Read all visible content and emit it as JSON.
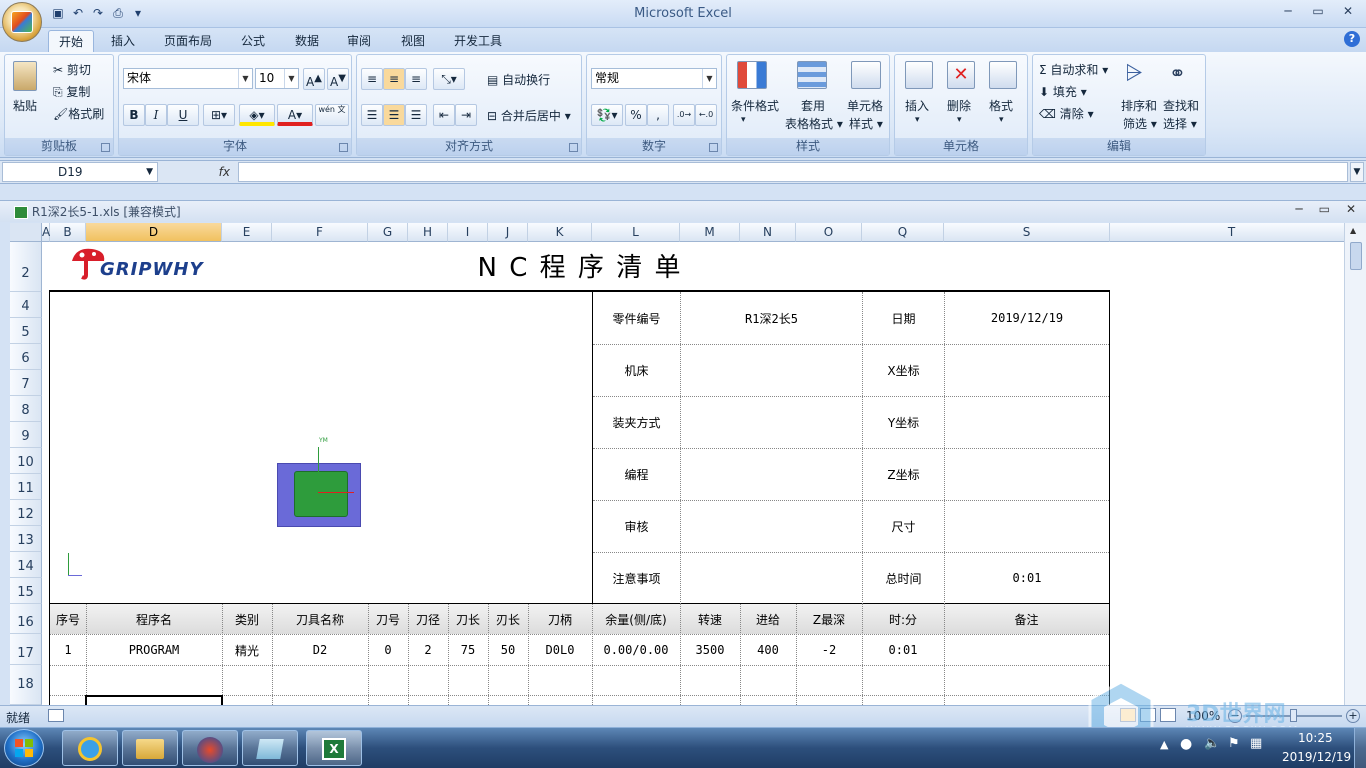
{
  "window": {
    "title": "Microsoft Excel"
  },
  "quick_access": {
    "customize": "▾"
  },
  "tabs": [
    {
      "label": "开始",
      "active": true
    },
    {
      "label": "插入"
    },
    {
      "label": "页面布局"
    },
    {
      "label": "公式"
    },
    {
      "label": "数据"
    },
    {
      "label": "审阅"
    },
    {
      "label": "视图"
    },
    {
      "label": "开发工具"
    }
  ],
  "ribbon": {
    "clipboard": {
      "label": "剪贴板",
      "paste": "粘贴",
      "cut": "剪切",
      "copy": "复制",
      "format_painter": "格式刷"
    },
    "font": {
      "label": "字体",
      "name": "宋体",
      "size": "10",
      "bold": "B",
      "italic": "I",
      "underline": "U",
      "phonetic": "wén 文"
    },
    "alignment": {
      "label": "对齐方式",
      "wrap": "自动换行",
      "merge": "合并后居中"
    },
    "number": {
      "label": "数字",
      "format": "常规",
      "percent": "%",
      "comma": ","
    },
    "styles": {
      "label": "样式",
      "conditional": "条件格式",
      "table_format_1": "套用",
      "table_format_2": "表格格式",
      "cell_styles_1": "单元格",
      "cell_styles_2": "样式"
    },
    "cells": {
      "label": "单元格",
      "insert": "插入",
      "delete": "删除",
      "format": "格式"
    },
    "editing": {
      "label": "编辑",
      "autosum": "自动求和",
      "fill": "填充",
      "clear": "清除",
      "sort_1": "排序和",
      "sort_2": "筛选",
      "find_1": "查找和",
      "find_2": "选择"
    }
  },
  "formula_bar": {
    "name_box": "D19",
    "fx": "fx",
    "value": ""
  },
  "workbook": {
    "title": "R1深2长5-1.xls  [兼容模式]"
  },
  "columns": [
    "A",
    "B",
    "D",
    "E",
    "F",
    "G",
    "H",
    "I",
    "J",
    "K",
    "L",
    "M",
    "N",
    "O",
    "Q",
    "S",
    "T"
  ],
  "rows": [
    "2",
    "4",
    "5",
    "6",
    "7",
    "8",
    "9",
    "10",
    "11",
    "12",
    "13",
    "14",
    "15",
    "16",
    "17",
    "18"
  ],
  "sheet": {
    "logo": "GRIPWHY",
    "title": "N C 程 序 清 单",
    "info": [
      {
        "l1": "零件编号",
        "v1": "R1深2长5",
        "l2": "日期",
        "v2": "2019/12/19"
      },
      {
        "l1": "机床",
        "v1": "",
        "l2": "X坐标",
        "v2": ""
      },
      {
        "l1": "装夹方式",
        "v1": "",
        "l2": "Y坐标",
        "v2": ""
      },
      {
        "l1": "编程",
        "v1": "",
        "l2": "Z坐标",
        "v2": ""
      },
      {
        "l1": "审核",
        "v1": "",
        "l2": "尺寸",
        "v2": ""
      },
      {
        "l1": "注意事项",
        "v1": "",
        "l2": "总时间",
        "v2": "0:01"
      }
    ],
    "headers": [
      "序号",
      "程序名",
      "类别",
      "刀具名称",
      "刀号",
      "刀径",
      "刀长",
      "刃长",
      "刀柄",
      "余量(侧/底)",
      "转速",
      "进给",
      "Z最深",
      "时:分",
      "备注"
    ],
    "rows": [
      [
        "1",
        "PROGRAM",
        "精光",
        "D2",
        "0",
        "2",
        "75",
        "50",
        "D0L0",
        "0.00/0.00",
        "3500",
        "400",
        "-2",
        "0:01",
        ""
      ]
    ],
    "axis_label": "YM"
  },
  "status": {
    "ready": "就绪",
    "zoom": "100%"
  },
  "watermark": {
    "text": "3D世界网",
    "url": "WWW.3DSJW.COM"
  },
  "clock": {
    "time": "10:25",
    "date": "2019/12/19"
  },
  "colors": {
    "part_outer": "#6a6ad8",
    "part_inner": "#2e9c3c",
    "accent": "#f1c15f"
  }
}
